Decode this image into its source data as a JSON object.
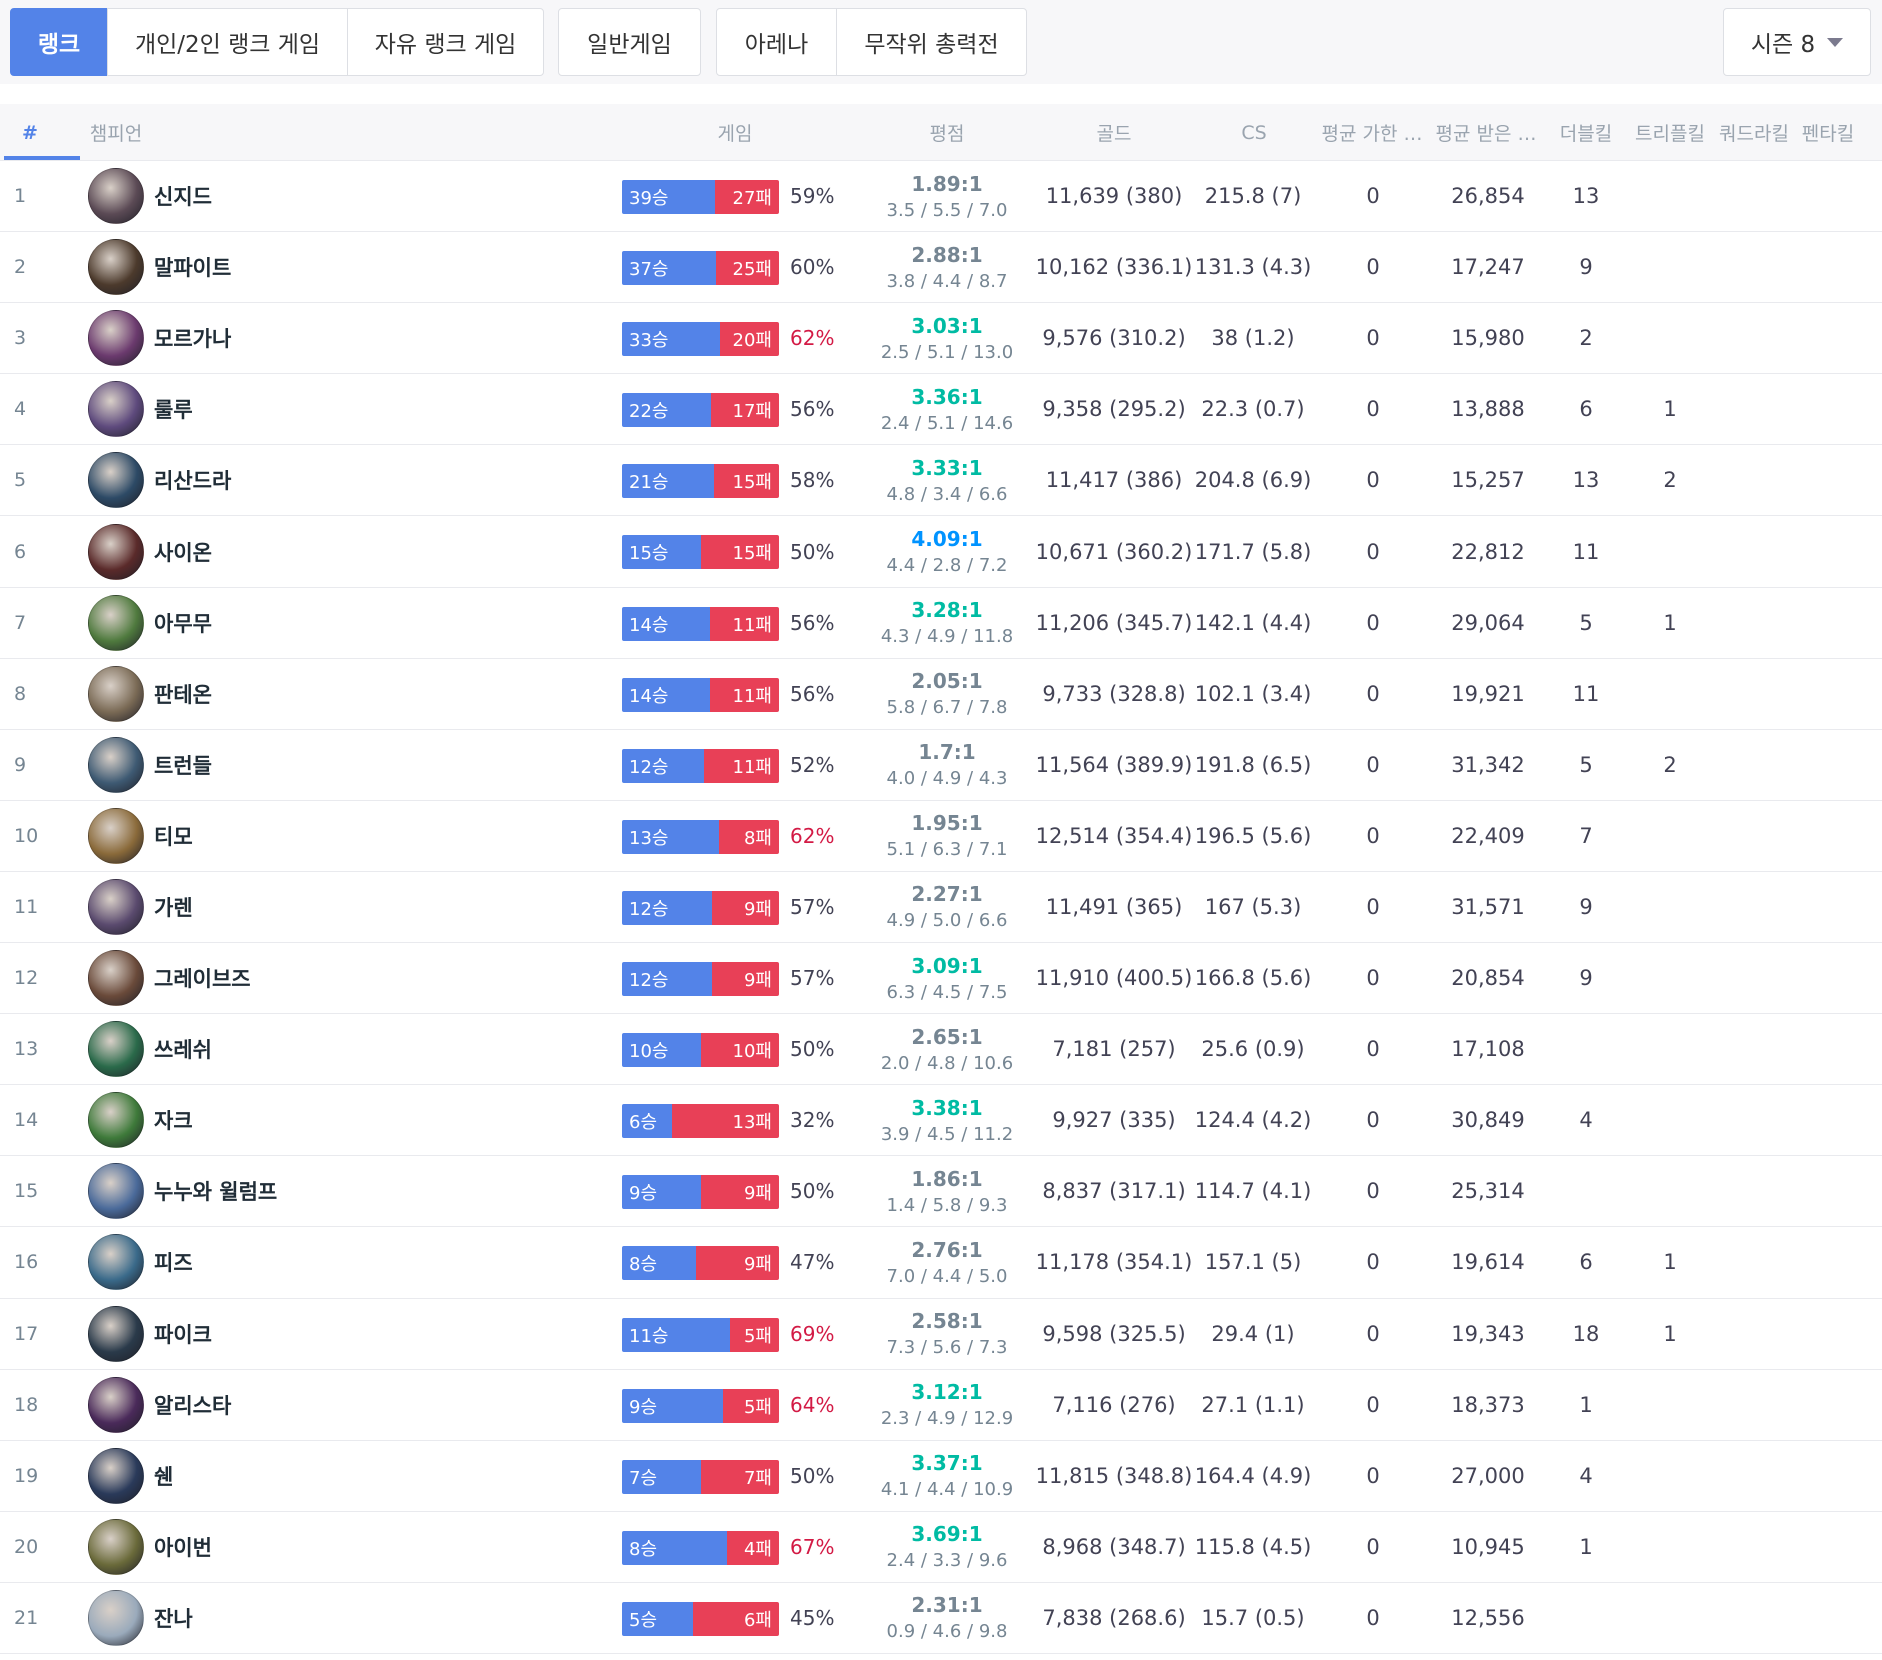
{
  "tabs": [
    {
      "label": "랭크",
      "active": true
    },
    {
      "label": "개인/2인 랭크 게임",
      "active": false
    },
    {
      "label": "자유 랭크 게임",
      "active": false
    },
    {
      "label": "일반게임",
      "active": false
    },
    {
      "label": "아레나",
      "active": false
    },
    {
      "label": "무작위 총력전",
      "active": false
    }
  ],
  "season": {
    "label": "시즌 8"
  },
  "headers": {
    "rank": "#",
    "champion": "챔피언",
    "games": "게임",
    "kda": "평점",
    "gold": "골드",
    "cs": "CS",
    "damage_dealt": "평균 가한 …",
    "damage_taken": "평균 받은 …",
    "double": "더블킬",
    "triple": "트리플킬",
    "quadra": "쿼드라킬",
    "penta": "펜타킬"
  },
  "colors": {
    "accent": "#5383e8",
    "loss": "#e84057",
    "win_rate_high": "#d31a45",
    "kda_good": "#00bba3",
    "kda_great": "#0093ff",
    "kda_normal": "#758592"
  },
  "rows": [
    {
      "rank": "1",
      "name": "신지드",
      "avatar": "#5b4a55",
      "wins": 39,
      "losses": 27,
      "win_label": "39승",
      "loss_label": "27패",
      "wr": "59%",
      "wr_hot": false,
      "ratio": "1.89:1",
      "ratio_tier": "normal",
      "kda": "3.5 / 5.5 / 7.0",
      "gold": "11,639 (380)",
      "cs": "215.8 (7)",
      "dealt": "0",
      "taken": "26,854",
      "double": "13",
      "triple": "",
      "quadra": "",
      "penta": ""
    },
    {
      "rank": "2",
      "name": "말파이트",
      "avatar": "#4c3a2c",
      "wins": 37,
      "losses": 25,
      "win_label": "37승",
      "loss_label": "25패",
      "wr": "60%",
      "wr_hot": false,
      "ratio": "2.88:1",
      "ratio_tier": "normal",
      "kda": "3.8 / 4.4 / 8.7",
      "gold": "10,162 (336.1)",
      "cs": "131.3 (4.3)",
      "dealt": "0",
      "taken": "17,247",
      "double": "9",
      "triple": "",
      "quadra": "",
      "penta": ""
    },
    {
      "rank": "3",
      "name": "모르가나",
      "avatar": "#6b3a6e",
      "wins": 33,
      "losses": 20,
      "win_label": "33승",
      "loss_label": "20패",
      "wr": "62%",
      "wr_hot": true,
      "ratio": "3.03:1",
      "ratio_tier": "good",
      "kda": "2.5 / 5.1 / 13.0",
      "gold": "9,576 (310.2)",
      "cs": "38 (1.2)",
      "dealt": "0",
      "taken": "15,980",
      "double": "2",
      "triple": "",
      "quadra": "",
      "penta": ""
    },
    {
      "rank": "4",
      "name": "룰루",
      "avatar": "#5e4a7d",
      "wins": 22,
      "losses": 17,
      "win_label": "22승",
      "loss_label": "17패",
      "wr": "56%",
      "wr_hot": false,
      "ratio": "3.36:1",
      "ratio_tier": "good",
      "kda": "2.4 / 5.1 / 14.6",
      "gold": "9,358 (295.2)",
      "cs": "22.3 (0.7)",
      "dealt": "0",
      "taken": "13,888",
      "double": "6",
      "triple": "1",
      "quadra": "",
      "penta": ""
    },
    {
      "rank": "5",
      "name": "리산드라",
      "avatar": "#2d4a66",
      "wins": 21,
      "losses": 15,
      "win_label": "21승",
      "loss_label": "15패",
      "wr": "58%",
      "wr_hot": false,
      "ratio": "3.33:1",
      "ratio_tier": "good",
      "kda": "4.8 / 3.4 / 6.6",
      "gold": "11,417 (386)",
      "cs": "204.8 (6.9)",
      "dealt": "0",
      "taken": "15,257",
      "double": "13",
      "triple": "2",
      "quadra": "",
      "penta": ""
    },
    {
      "rank": "6",
      "name": "사이온",
      "avatar": "#5a2a2a",
      "wins": 15,
      "losses": 15,
      "win_label": "15승",
      "loss_label": "15패",
      "wr": "50%",
      "wr_hot": false,
      "ratio": "4.09:1",
      "ratio_tier": "great",
      "kda": "4.4 / 2.8 / 7.2",
      "gold": "10,671 (360.2)",
      "cs": "171.7 (5.8)",
      "dealt": "0",
      "taken": "22,812",
      "double": "11",
      "triple": "",
      "quadra": "",
      "penta": ""
    },
    {
      "rank": "7",
      "name": "아무무",
      "avatar": "#4f7a3e",
      "wins": 14,
      "losses": 11,
      "win_label": "14승",
      "loss_label": "11패",
      "wr": "56%",
      "wr_hot": false,
      "ratio": "3.28:1",
      "ratio_tier": "good",
      "kda": "4.3 / 4.9 / 11.8",
      "gold": "11,206 (345.7)",
      "cs": "142.1 (4.4)",
      "dealt": "0",
      "taken": "29,064",
      "double": "5",
      "triple": "1",
      "quadra": "",
      "penta": ""
    },
    {
      "rank": "8",
      "name": "판테온",
      "avatar": "#7a6a55",
      "wins": 14,
      "losses": 11,
      "win_label": "14승",
      "loss_label": "11패",
      "wr": "56%",
      "wr_hot": false,
      "ratio": "2.05:1",
      "ratio_tier": "normal",
      "kda": "5.8 / 6.7 / 7.8",
      "gold": "9,733 (328.8)",
      "cs": "102.1 (3.4)",
      "dealt": "0",
      "taken": "19,921",
      "double": "11",
      "triple": "",
      "quadra": "",
      "penta": ""
    },
    {
      "rank": "9",
      "name": "트런들",
      "avatar": "#3e5a73",
      "wins": 12,
      "losses": 11,
      "win_label": "12승",
      "loss_label": "11패",
      "wr": "52%",
      "wr_hot": false,
      "ratio": "1.7:1",
      "ratio_tier": "normal",
      "kda": "4.0 / 4.9 / 4.3",
      "gold": "11,564 (389.9)",
      "cs": "191.8 (6.5)",
      "dealt": "0",
      "taken": "31,342",
      "double": "5",
      "triple": "2",
      "quadra": "",
      "penta": ""
    },
    {
      "rank": "10",
      "name": "티모",
      "avatar": "#8a6a3a",
      "wins": 13,
      "losses": 8,
      "win_label": "13승",
      "loss_label": "8패",
      "wr": "62%",
      "wr_hot": true,
      "ratio": "1.95:1",
      "ratio_tier": "normal",
      "kda": "5.1 / 6.3 / 7.1",
      "gold": "12,514 (354.4)",
      "cs": "196.5 (5.6)",
      "dealt": "0",
      "taken": "22,409",
      "double": "7",
      "triple": "",
      "quadra": "",
      "penta": ""
    },
    {
      "rank": "11",
      "name": "가렌",
      "avatar": "#5a4a6e",
      "wins": 12,
      "losses": 9,
      "win_label": "12승",
      "loss_label": "9패",
      "wr": "57%",
      "wr_hot": false,
      "ratio": "2.27:1",
      "ratio_tier": "normal",
      "kda": "4.9 / 5.0 / 6.6",
      "gold": "11,491 (365)",
      "cs": "167 (5.3)",
      "dealt": "0",
      "taken": "31,571",
      "double": "9",
      "triple": "",
      "quadra": "",
      "penta": ""
    },
    {
      "rank": "12",
      "name": "그레이브즈",
      "avatar": "#6a4a3a",
      "wins": 12,
      "losses": 9,
      "win_label": "12승",
      "loss_label": "9패",
      "wr": "57%",
      "wr_hot": false,
      "ratio": "3.09:1",
      "ratio_tier": "good",
      "kda": "6.3 / 4.5 / 7.5",
      "gold": "11,910 (400.5)",
      "cs": "166.8 (5.6)",
      "dealt": "0",
      "taken": "20,854",
      "double": "9",
      "triple": "",
      "quadra": "",
      "penta": ""
    },
    {
      "rank": "13",
      "name": "쓰레쉬",
      "avatar": "#2a6a4a",
      "wins": 10,
      "losses": 10,
      "win_label": "10승",
      "loss_label": "10패",
      "wr": "50%",
      "wr_hot": false,
      "ratio": "2.65:1",
      "ratio_tier": "normal",
      "kda": "2.0 / 4.8 / 10.6",
      "gold": "7,181 (257)",
      "cs": "25.6 (0.9)",
      "dealt": "0",
      "taken": "17,108",
      "double": "",
      "triple": "",
      "quadra": "",
      "penta": ""
    },
    {
      "rank": "14",
      "name": "자크",
      "avatar": "#3e7a3a",
      "wins": 6,
      "losses": 13,
      "win_label": "6승",
      "loss_label": "13패",
      "wr": "32%",
      "wr_hot": false,
      "ratio": "3.38:1",
      "ratio_tier": "good",
      "kda": "3.9 / 4.5 / 11.2",
      "gold": "9,927 (335)",
      "cs": "124.4 (4.2)",
      "dealt": "0",
      "taken": "30,849",
      "double": "4",
      "triple": "",
      "quadra": "",
      "penta": ""
    },
    {
      "rank": "15",
      "name": "누누와 윌럼프",
      "avatar": "#4a6a9a",
      "wins": 9,
      "losses": 9,
      "win_label": "9승",
      "loss_label": "9패",
      "wr": "50%",
      "wr_hot": false,
      "ratio": "1.86:1",
      "ratio_tier": "normal",
      "kda": "1.4 / 5.8 / 9.3",
      "gold": "8,837 (317.1)",
      "cs": "114.7 (4.1)",
      "dealt": "0",
      "taken": "25,314",
      "double": "",
      "triple": "",
      "quadra": "",
      "penta": ""
    },
    {
      "rank": "16",
      "name": "피즈",
      "avatar": "#3a6a8a",
      "wins": 8,
      "losses": 9,
      "win_label": "8승",
      "loss_label": "9패",
      "wr": "47%",
      "wr_hot": false,
      "ratio": "2.76:1",
      "ratio_tier": "normal",
      "kda": "7.0 / 4.4 / 5.0",
      "gold": "11,178 (354.1)",
      "cs": "157.1 (5)",
      "dealt": "0",
      "taken": "19,614",
      "double": "6",
      "triple": "1",
      "quadra": "",
      "penta": ""
    },
    {
      "rank": "17",
      "name": "파이크",
      "avatar": "#2a3a4a",
      "wins": 11,
      "losses": 5,
      "win_label": "11승",
      "loss_label": "5패",
      "wr": "69%",
      "wr_hot": true,
      "ratio": "2.58:1",
      "ratio_tier": "normal",
      "kda": "7.3 / 5.6 / 7.3",
      "gold": "9,598 (325.5)",
      "cs": "29.4 (1)",
      "dealt": "0",
      "taken": "19,343",
      "double": "18",
      "triple": "1",
      "quadra": "",
      "penta": ""
    },
    {
      "rank": "18",
      "name": "알리스타",
      "avatar": "#4a2a5a",
      "wins": 9,
      "losses": 5,
      "win_label": "9승",
      "loss_label": "5패",
      "wr": "64%",
      "wr_hot": true,
      "ratio": "3.12:1",
      "ratio_tier": "good",
      "kda": "2.3 / 4.9 / 12.9",
      "gold": "7,116 (276)",
      "cs": "27.1 (1.1)",
      "dealt": "0",
      "taken": "18,373",
      "double": "1",
      "triple": "",
      "quadra": "",
      "penta": ""
    },
    {
      "rank": "19",
      "name": "쉔",
      "avatar": "#2a3a5a",
      "wins": 7,
      "losses": 7,
      "win_label": "7승",
      "loss_label": "7패",
      "wr": "50%",
      "wr_hot": false,
      "ratio": "3.37:1",
      "ratio_tier": "good",
      "kda": "4.1 / 4.4 / 10.9",
      "gold": "11,815 (348.8)",
      "cs": "164.4 (4.9)",
      "dealt": "0",
      "taken": "27,000",
      "double": "4",
      "triple": "",
      "quadra": "",
      "penta": ""
    },
    {
      "rank": "20",
      "name": "아이번",
      "avatar": "#6a6a3a",
      "wins": 8,
      "losses": 4,
      "win_label": "8승",
      "loss_label": "4패",
      "wr": "67%",
      "wr_hot": true,
      "ratio": "3.69:1",
      "ratio_tier": "good",
      "kda": "2.4 / 3.3 / 9.6",
      "gold": "8,968 (348.7)",
      "cs": "115.8 (4.5)",
      "dealt": "0",
      "taken": "10,945",
      "double": "1",
      "triple": "",
      "quadra": "",
      "penta": ""
    },
    {
      "rank": "21",
      "name": "잔나",
      "avatar": "#9aaabb",
      "wins": 5,
      "losses": 6,
      "win_label": "5승",
      "loss_label": "6패",
      "wr": "45%",
      "wr_hot": false,
      "ratio": "2.31:1",
      "ratio_tier": "normal",
      "kda": "0.9 / 4.6 / 9.8",
      "gold": "7,838 (268.6)",
      "cs": "15.7 (0.5)",
      "dealt": "0",
      "taken": "12,556",
      "double": "",
      "triple": "",
      "quadra": "",
      "penta": ""
    }
  ]
}
